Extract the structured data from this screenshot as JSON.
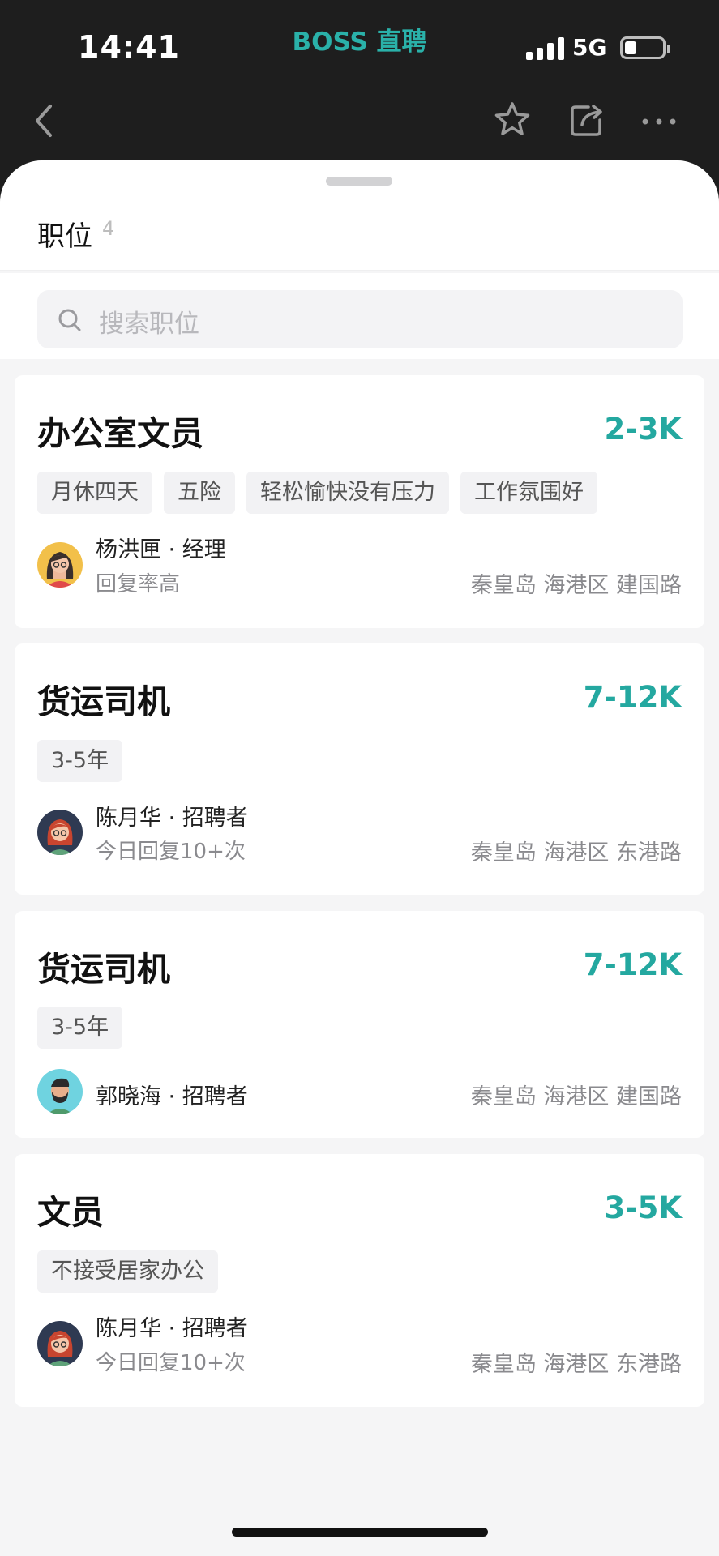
{
  "status_bar": {
    "time": "14:41",
    "brand": "BOSS 直聘",
    "network": "5G"
  },
  "sheet": {
    "title": "职位",
    "count": "4",
    "search_placeholder": "搜索职位"
  },
  "icons": {
    "back": "chevron-left-icon",
    "favorite": "star-icon",
    "share": "share-icon",
    "more": "more-dots-icon",
    "search": "search-icon"
  },
  "colors": {
    "accent": "#24a8a0",
    "brand": "#2ab1a9",
    "tag_bg": "#f2f2f4"
  },
  "jobs": [
    {
      "title": "办公室文员",
      "salary": "2-3K",
      "tags": [
        "月休四天",
        "五险",
        "轻松愉快没有压力",
        "工作氛围好"
      ],
      "recruiter": "杨洪匣 · 经理",
      "status": "回复率高",
      "location": "秦皇岛  海港区  建国路"
    },
    {
      "title": "货运司机",
      "salary": "7-12K",
      "tags": [
        "3-5年"
      ],
      "recruiter": "陈月华 · 招聘者",
      "status": "今日回复10+次",
      "location": "秦皇岛  海港区  东港路"
    },
    {
      "title": "货运司机",
      "salary": "7-12K",
      "tags": [
        "3-5年"
      ],
      "recruiter": "郭晓海 · 招聘者",
      "status": "",
      "location": "秦皇岛  海港区  建国路"
    },
    {
      "title": "文员",
      "salary": "3-5K",
      "tags": [
        "不接受居家办公"
      ],
      "recruiter": "陈月华 · 招聘者",
      "status": "今日回复10+次",
      "location": "秦皇岛  海港区  东港路"
    }
  ]
}
